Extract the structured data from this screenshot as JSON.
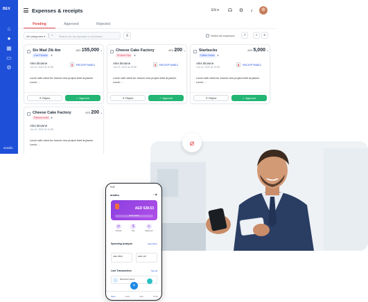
{
  "app": {
    "rail": {
      "logo": "BEX",
      "footer": "anadio"
    },
    "title": "Expenses & receipts",
    "language": "EN",
    "tabs": [
      {
        "label": "Pending",
        "active": true
      },
      {
        "label": "Approved",
        "active": false
      },
      {
        "label": "Rejected",
        "active": false
      }
    ],
    "filters": {
      "category_value": "All categories",
      "search_placeholder": "Search for an expense or merchant",
      "select_all_label": "Select all expenses"
    },
    "cards": [
      {
        "merchant": "Six Mad Zik Am",
        "currency": "AED",
        "amount": "155,000",
        "tag": "Live Product",
        "tag_style": "blue",
        "person": "Alex Browne",
        "date": "Jun 13, 2022 at 13:38",
        "receipt": "RECEIPT#6812",
        "note": "Lunch with client for brunch new project brief at jasmin Lunch ...",
        "reject_label": "Reject",
        "approve_label": "Approve"
      },
      {
        "merchant": "Cheese Cake Factory",
        "currency": "AED",
        "amount": "200",
        "tag": "Product Ops",
        "tag_style": "pink",
        "person": "Alex Browne",
        "date": "Jun 13, 2022 at 13:38",
        "receipt": "RECEIPT#6812",
        "note": "Lunch with client for brunch new project brief at jasmin Lunch ...",
        "reject_label": "Reject",
        "approve_label": "Approve"
      },
      {
        "merchant": "Starbucks",
        "currency": "AED",
        "amount": "5,000",
        "tag": "Online Hours",
        "tag_style": "blue",
        "person": "Alex Browne",
        "date": "Jun 13, 2022 at 13:38",
        "receipt": "RECEIPT#6812",
        "note": "Lunch with client for brunch new project brief at jasmin Lunch ...",
        "reject_label": "Reject",
        "approve_label": "Approve"
      },
      {
        "merchant": "Cheese Cake Factory",
        "currency": "AED",
        "amount": "200",
        "tag": "Patrone more",
        "tag_style": "pink",
        "person": "Alex Browne",
        "date": "Jun 13, 2022 at 13:38",
        "receipt": "",
        "note": "Lunch with client for brunch new project brief at jasmin Lunch ...",
        "reject_label": "",
        "approve_label": ""
      }
    ],
    "colors": {
      "rail": "#1e4fd8",
      "approve": "#22b573",
      "active_tab": "#e5484d",
      "link": "#1e4fd8"
    }
  },
  "phone": {
    "status_time": "9:41",
    "brand": "anadio",
    "card_balance": "AED 528.53",
    "card_bar": "Card number",
    "actions": [
      "Transfer",
      "Pay",
      "Statement"
    ],
    "spending_title": "Spending Analysis",
    "spending_link": "View More",
    "box_left_value": "AED 2890",
    "box_right_value": "AED 125",
    "transactions_title": "Last Transactions",
    "transactions_link": "See all",
    "transaction_label": "Merchant Name",
    "nav": [
      "Home",
      "Cards",
      "Stats",
      "Profile"
    ]
  },
  "badge_icon": "paperclip-icon"
}
